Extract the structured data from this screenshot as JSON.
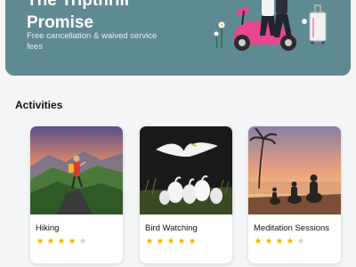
{
  "promo": {
    "title_line1": "The Tripthrill",
    "title_line2": "Promise",
    "subtitle": "Free cancellation & waived service fees"
  },
  "section": {
    "title": "Activities"
  },
  "activities": [
    {
      "label": "Hiking",
      "rating": 4,
      "max": 5,
      "image": "hiker-on-mountain-sunset"
    },
    {
      "label": "Bird Watching",
      "rating": 5,
      "max": 5,
      "image": "egrets-in-marsh"
    },
    {
      "label": "Meditation Sessions",
      "rating": 4,
      "max": 5,
      "image": "people-meditating-on-beach-sunset"
    }
  ],
  "colors": {
    "banner": "#5e8a93",
    "star_on": "#f2b705",
    "star_off": "#d1d1d1"
  }
}
